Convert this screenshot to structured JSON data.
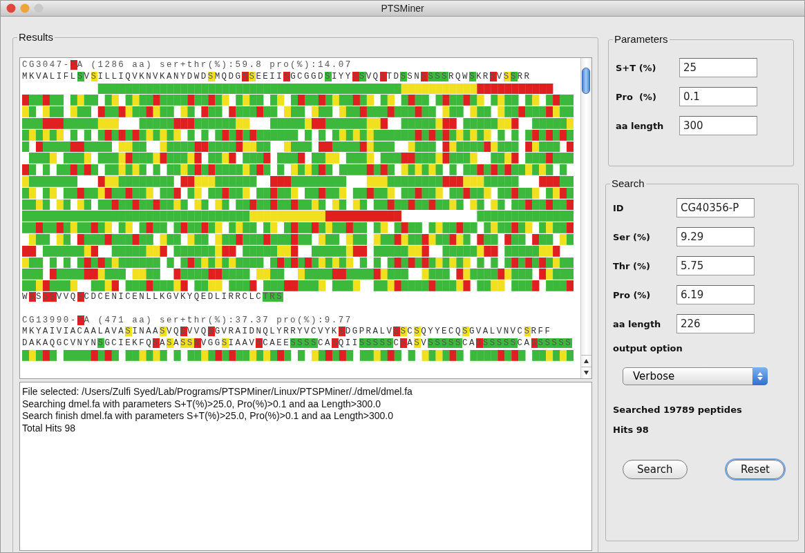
{
  "window": {
    "title": "PTSMiner"
  },
  "results": {
    "title": "Results",
    "entries": [
      {
        "header": [
          {
            "text": "CG3047-"
          },
          {
            "text": "P",
            "color": "#e02020"
          },
          {
            "text": "A (1286 aa) ser+thr(%):59.8 pro(%):14.07"
          }
        ],
        "lines": [
          {
            "kind": "text",
            "segments": [
              {
                "text": "MKVALIFL"
              },
              {
                "text": "S",
                "color": "#3cb83c"
              },
              {
                "text": "V"
              },
              {
                "text": "S",
                "color": "#f0e020"
              },
              {
                "text": "ILLIQVKNVKANYDWD"
              },
              {
                "text": "S",
                "color": "#f0e020"
              },
              {
                "text": "MQDG"
              },
              {
                "text": "S",
                "color": "#e02020"
              },
              {
                "text": "S",
                "color": "#f0e020"
              },
              {
                "text": "EEII"
              },
              {
                "text": "S",
                "color": "#e02020"
              },
              {
                "text": "GCGGD"
              },
              {
                "text": "S",
                "color": "#3cb83c"
              },
              {
                "text": "IYY"
              },
              {
                "text": "S",
                "color": "#e02020"
              },
              {
                "text": "S",
                "color": "#3cb83c"
              },
              {
                "text": "VQ"
              },
              {
                "text": "S",
                "color": "#e02020"
              },
              {
                "text": "TD"
              },
              {
                "text": "S",
                "color": "#3cb83c"
              },
              {
                "text": "SN"
              },
              {
                "text": "S",
                "color": "#e02020"
              },
              {
                "text": "SSS",
                "color": "#3cb83c"
              },
              {
                "text": "RQW"
              },
              {
                "text": "S",
                "color": "#3cb83c"
              },
              {
                "text": "KR"
              },
              {
                "text": "S",
                "color": "#e02020"
              },
              {
                "text": "V"
              },
              {
                "text": "S",
                "color": "#f0e020"
              },
              {
                "text": "S",
                "color": "#3cb83c"
              },
              {
                "text": "RR"
              }
            ]
          },
          {
            "kind": "highlighted"
          },
          {
            "kind": "highlighted"
          },
          {
            "kind": "highlighted"
          },
          {
            "kind": "highlighted"
          },
          {
            "kind": "highlighted"
          },
          {
            "kind": "highlighted"
          },
          {
            "kind": "highlighted"
          },
          {
            "kind": "highlighted"
          },
          {
            "kind": "highlighted"
          },
          {
            "kind": "highlighted"
          },
          {
            "kind": "highlighted"
          },
          {
            "kind": "highlighted"
          },
          {
            "kind": "highlighted"
          },
          {
            "kind": "highlighted"
          },
          {
            "kind": "highlighted"
          },
          {
            "kind": "highlighted"
          },
          {
            "kind": "highlighted"
          },
          {
            "kind": "highlighted"
          },
          {
            "kind": "text",
            "segments": [
              {
                "text": "W"
              },
              {
                "text": "S",
                "color": "#e02020"
              },
              {
                "text": "S"
              },
              {
                "text": "SS",
                "color": "#e02020"
              },
              {
                "text": "VVQ"
              },
              {
                "text": "S",
                "color": "#e02020"
              },
              {
                "text": "CDCENICENLLKGVKYQEDLIRRCLC"
              },
              {
                "text": "T",
                "color": "#3cb83c"
              },
              {
                "text": "RS",
                "color": "#3cb83c"
              }
            ]
          }
        ]
      },
      {
        "header": [
          {
            "text": "CG13990-"
          },
          {
            "text": "P",
            "color": "#e02020"
          },
          {
            "text": "A (471 aa) ser+thr(%):37.37 pro(%):9.77"
          }
        ],
        "lines": [
          {
            "kind": "text",
            "segments": [
              {
                "text": "MKYAIVIACAALAVA"
              },
              {
                "text": "S",
                "color": "#f0e020"
              },
              {
                "text": "INAA"
              },
              {
                "text": "S",
                "color": "#f0e020"
              },
              {
                "text": "VQ"
              },
              {
                "text": "S",
                "color": "#e02020"
              },
              {
                "text": "VVQ"
              },
              {
                "text": "S",
                "color": "#e02020"
              },
              {
                "text": "GVRAIDNQLYRRYVCVYK"
              },
              {
                "text": "S",
                "color": "#e02020"
              },
              {
                "text": "DGPRALV"
              },
              {
                "text": "S",
                "color": "#e02020"
              },
              {
                "text": "S",
                "color": "#f0e020"
              },
              {
                "text": "C"
              },
              {
                "text": "S",
                "color": "#f0e020"
              },
              {
                "text": "QYYECQ"
              },
              {
                "text": "S",
                "color": "#f0e020"
              },
              {
                "text": "GVALVNVC"
              },
              {
                "text": "S",
                "color": "#f0e020"
              },
              {
                "text": "RFF"
              }
            ]
          },
          {
            "kind": "text",
            "segments": [
              {
                "text": "DAKAQGCVNYN"
              },
              {
                "text": "S",
                "color": "#3cb83c"
              },
              {
                "text": "GCIEKFQ"
              },
              {
                "text": "S",
                "color": "#e02020"
              },
              {
                "text": "A"
              },
              {
                "text": "S",
                "color": "#f0e020"
              },
              {
                "text": "A"
              },
              {
                "text": "SS",
                "color": "#f0e020"
              },
              {
                "text": "S",
                "color": "#e02020"
              },
              {
                "text": "VGG"
              },
              {
                "text": "S",
                "color": "#f0e020"
              },
              {
                "text": "IAAV"
              },
              {
                "text": "S",
                "color": "#e02020"
              },
              {
                "text": "CAEE"
              },
              {
                "text": "SSSS",
                "color": "#3cb83c"
              },
              {
                "text": "CA"
              },
              {
                "text": "S",
                "color": "#e02020"
              },
              {
                "text": "QII"
              },
              {
                "text": "SSSSS",
                "color": "#3cb83c"
              },
              {
                "text": "C"
              },
              {
                "text": "S",
                "color": "#e02020"
              },
              {
                "text": "A"
              },
              {
                "text": "S",
                "color": "#f0e020"
              },
              {
                "text": "V"
              },
              {
                "text": "SSSSS",
                "color": "#3cb83c"
              },
              {
                "text": "CA"
              },
              {
                "text": "S",
                "color": "#e02020"
              },
              {
                "text": "SSSSS",
                "color": "#3cb83c"
              },
              {
                "text": "CA"
              },
              {
                "text": "S",
                "color": "#e02020"
              },
              {
                "text": "SSSSS",
                "color": "#3cb83c"
              }
            ]
          },
          {
            "kind": "highlighted"
          }
        ]
      }
    ]
  },
  "log": [
    "File selected: /Users/Zulfi Syed/Lab/Programs/PTSPMiner/Linux/PTSPMiner/./dmel/dmel.fa",
    "Searching dmel.fa with parameters S+T(%)>25.0, Pro(%)>0.1 and aa Length>300.0",
    "Search finish dmel.fa with parameters S+T(%)>25.0, Pro(%)>0.1 and aa Length>300.0",
    "Total Hits 98"
  ],
  "parameters": {
    "title": "Parameters",
    "fields": [
      {
        "label": "S+T (%)",
        "value": "25"
      },
      {
        "label": "Pro  (%)",
        "value": "0.1"
      },
      {
        "label": "aa length",
        "value": "300"
      }
    ]
  },
  "search": {
    "title": "Search",
    "fields": [
      {
        "label": "ID",
        "value": "CG40356-P"
      },
      {
        "label": "Ser (%)",
        "value": "9.29"
      },
      {
        "label": "Thr (%)",
        "value": "5.75"
      },
      {
        "label": "Pro (%)",
        "value": "6.19"
      },
      {
        "label": "aa length",
        "value": "226"
      }
    ],
    "output_option": {
      "label": "output option",
      "value": "Verbose"
    },
    "status": [
      "Searched 19789 peptides",
      "Hits 98"
    ],
    "buttons": [
      {
        "label": "Search",
        "focused": false
      },
      {
        "label": "Reset",
        "focused": true
      }
    ]
  }
}
